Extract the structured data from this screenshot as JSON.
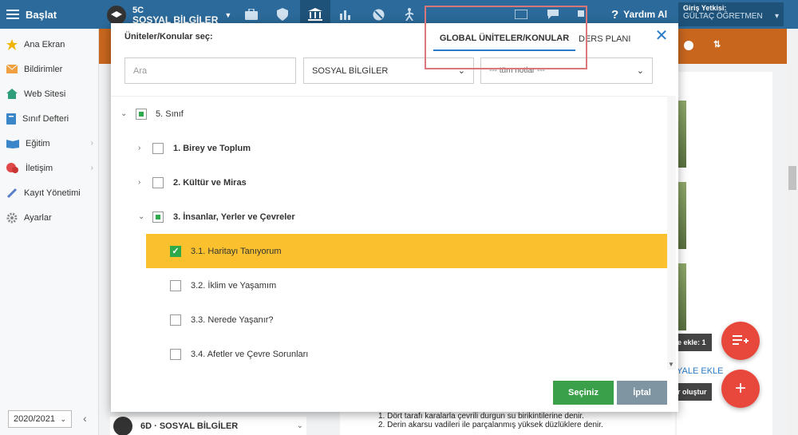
{
  "topbar": {
    "brand_label": "Başlat",
    "class_code": "5C",
    "class_subject": "SOSYAL BİLGİLER",
    "help_label": "Yardım Al",
    "role_title": "Giriş Yetkisi:",
    "role_user": "GÜLTAÇ ÖĞRETMEN"
  },
  "sidebar": {
    "items": [
      {
        "label": "Ana Ekran"
      },
      {
        "label": "Bildirimler"
      },
      {
        "label": "Web Sitesi"
      },
      {
        "label": "Sınıf Defteri"
      },
      {
        "label": "Eğitim"
      },
      {
        "label": "İletişim"
      },
      {
        "label": "Kayıt Yönetimi"
      },
      {
        "label": "Ayarlar"
      }
    ],
    "year": "2020/2021"
  },
  "background": {
    "add_label": "e ekle: 1",
    "create_label": "r oluştur",
    "link_add": "YALE EKLE",
    "bottom_class": "6D · SOSYAL BİLGİLER",
    "list_lines": [
      "1. Dört tarafı karalarla çevrili durgun su birikintilerine denir.",
      "2. Derin akarsu vadileri ile parçalanmış yüksek düzlüklere denir."
    ]
  },
  "modal": {
    "title": "Üniteler/Konular seç:",
    "tab_global": "GLOBAL ÜNİTELER/KONULAR",
    "tab_plan": "DERS PLANI",
    "search_placeholder": "Ara",
    "subject_value": "SOSYAL BİLGİLER",
    "level_value": "--- tüm notlar ---",
    "tree": {
      "root": "5. Sınıf",
      "units": [
        {
          "label": "1. Birey ve Toplum"
        },
        {
          "label": "2. Kültür ve Miras"
        },
        {
          "label": "3. İnsanlar, Yerler ve Çevreler"
        }
      ],
      "topics": [
        {
          "label": "3.1. Haritayı Tanıyorum"
        },
        {
          "label": "3.2. İklim ve Yaşamım"
        },
        {
          "label": "3.3. Nerede Yaşanır?"
        },
        {
          "label": "3.4. Afetler ve Çevre Sorunları"
        }
      ]
    },
    "select_label": "Seçiniz",
    "cancel_label": "İptal"
  }
}
